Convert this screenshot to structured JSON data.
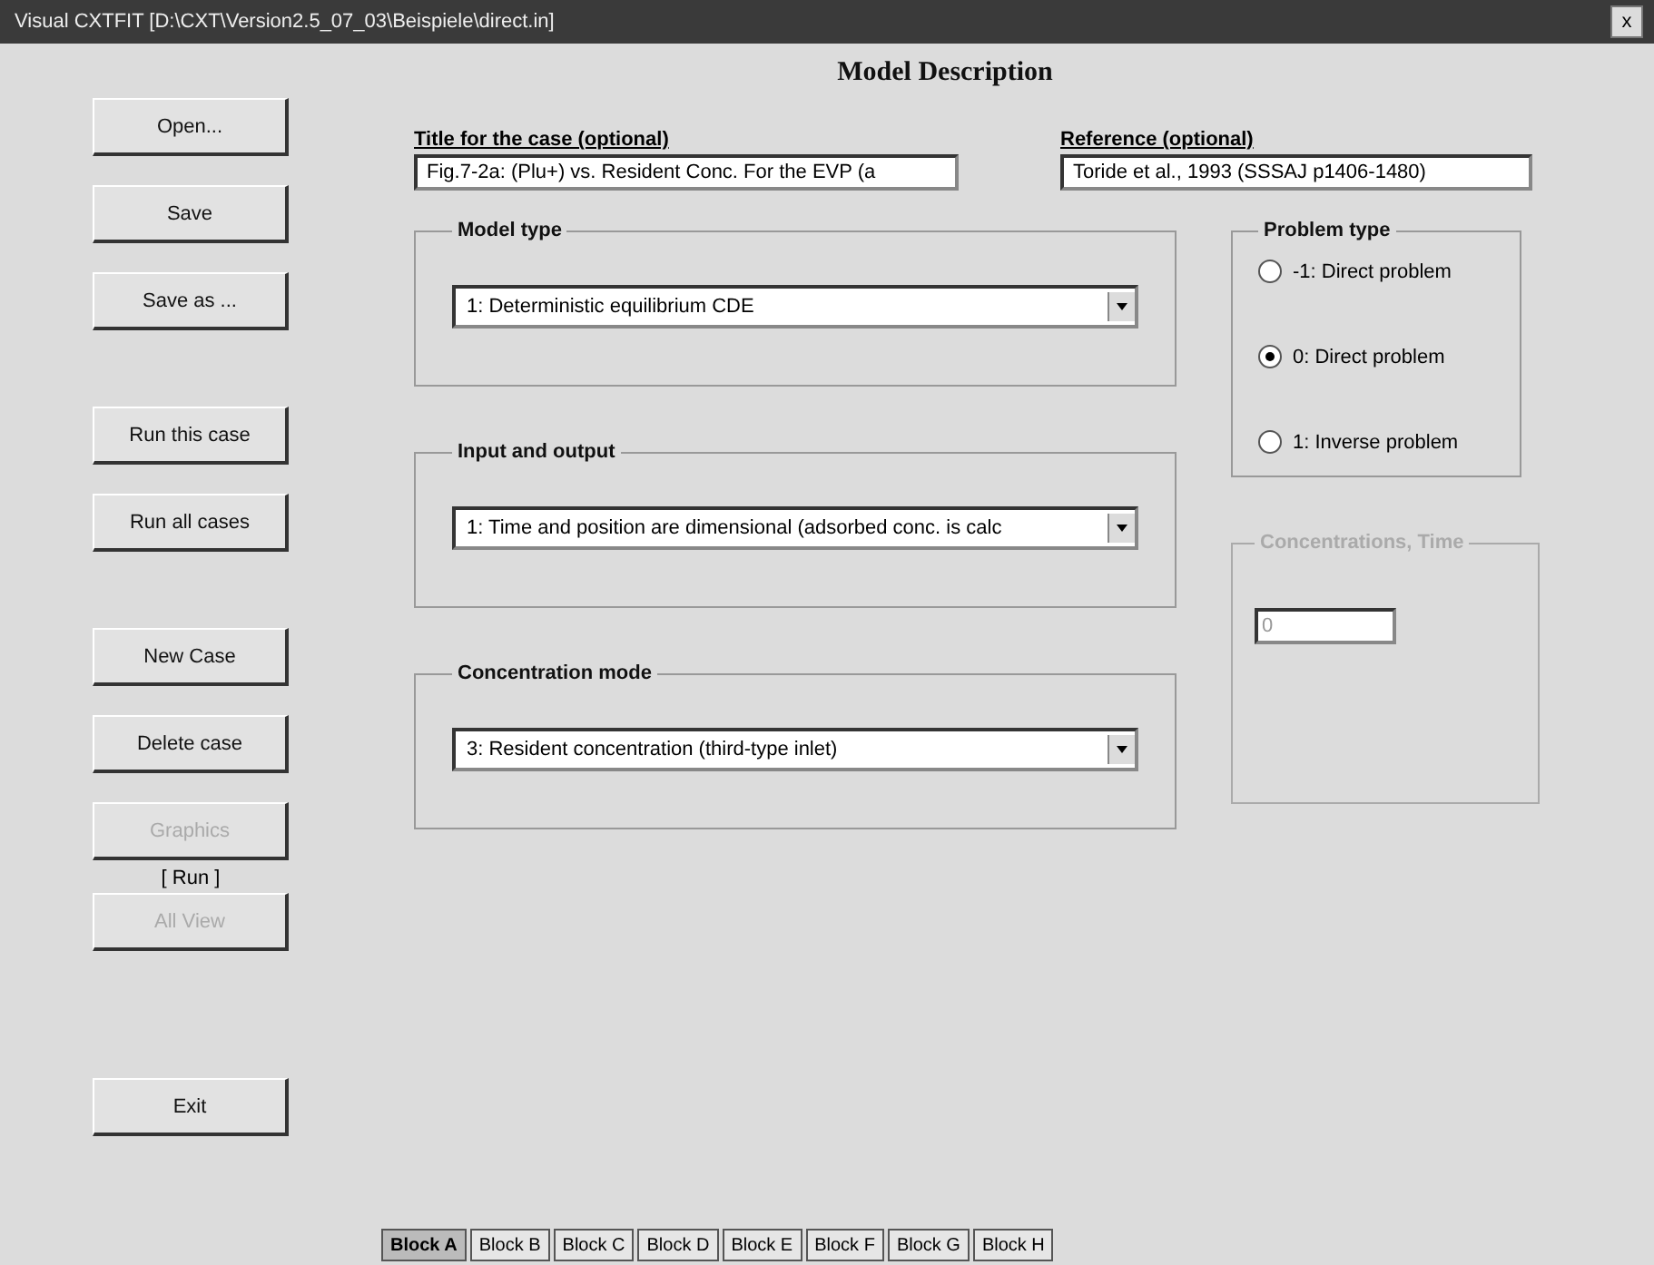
{
  "window": {
    "title": "Visual CXTFIT  [D:\\CXT\\Version2.5_07_03\\Beispiele\\direct.in]",
    "close": "x"
  },
  "side_button_groups": [
    [
      {
        "label": "Open...",
        "disabled": false
      },
      {
        "label": "Save",
        "disabled": false
      },
      {
        "label": "Save as ...",
        "disabled": false
      }
    ],
    [
      {
        "label": "Run this case",
        "disabled": false
      },
      {
        "label": "Run all cases",
        "disabled": false
      }
    ],
    [
      {
        "label": "New Case",
        "disabled": false
      },
      {
        "label": "Delete case",
        "disabled": false
      },
      {
        "label": "Graphics",
        "disabled": true
      }
    ]
  ],
  "run_note": "[ Run ]",
  "view_button": {
    "label": "All View",
    "disabled": true
  },
  "exit_button": "Exit",
  "heading": "Model Description",
  "title_field": {
    "label": "Title for the case (optional)",
    "value": "Fig.7-2a: (Plu+) vs. Resident Conc. For the EVP (a"
  },
  "reference_field": {
    "label": "Reference (optional)",
    "value": "Toride et al., 1993 (SSSAJ p1406-1480)"
  },
  "groups": [
    {
      "title": "Model type",
      "value": "1: Deterministic equilibrium CDE"
    },
    {
      "title": "Input and output",
      "value": "1: Time and position are dimensional (adsorbed conc. is calc"
    },
    {
      "title": "Concentration mode",
      "value": "3: Resident concentration (third-type inlet)"
    }
  ],
  "problem_type": {
    "title": "Problem type",
    "options": [
      {
        "label": "-1: Direct problem",
        "selected": false
      },
      {
        "label": "0: Direct problem",
        "selected": true
      },
      {
        "label": "1: Inverse problem",
        "selected": false
      }
    ]
  },
  "concentration_group": {
    "title": "Concentrations, Time",
    "disabled": true,
    "value": "0"
  },
  "tabs": [
    {
      "label": "Block A",
      "selected": true
    },
    {
      "label": "Block B",
      "selected": false
    },
    {
      "label": "Block C",
      "selected": false
    },
    {
      "label": "Block D",
      "selected": false
    },
    {
      "label": "Block E",
      "selected": false
    },
    {
      "label": "Block F",
      "selected": false
    },
    {
      "label": "Block G",
      "selected": false
    },
    {
      "label": "Block H",
      "selected": false
    }
  ]
}
